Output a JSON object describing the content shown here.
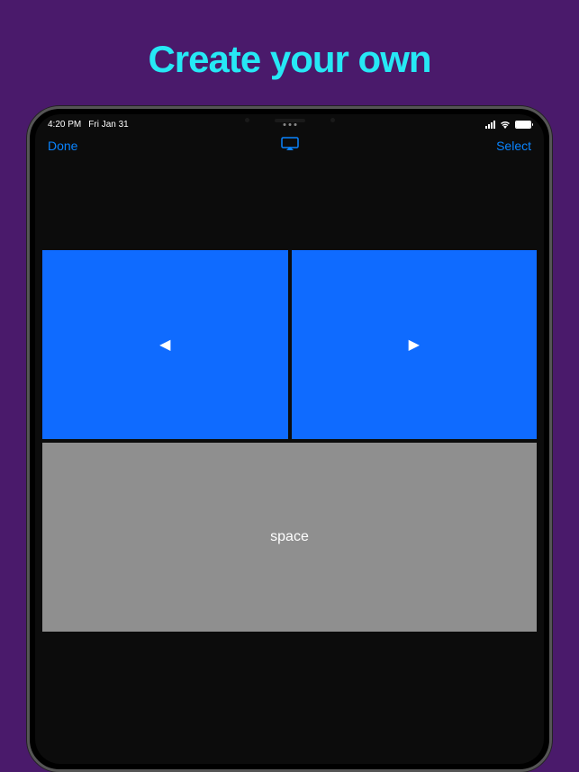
{
  "headline": "Create your own",
  "status_bar": {
    "time": "4:20 PM",
    "date": "Fri Jan 31"
  },
  "nav": {
    "done_label": "Done",
    "select_label": "Select"
  },
  "controls": {
    "prev_icon": "◀",
    "next_icon": "▶",
    "space_label": "space"
  }
}
